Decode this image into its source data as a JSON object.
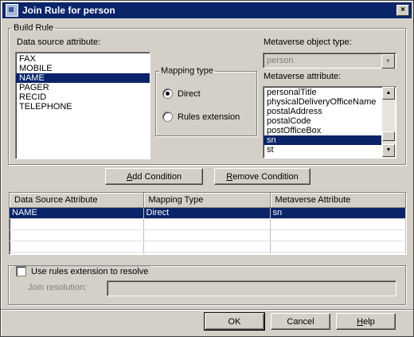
{
  "window": {
    "title": "Join Rule for person",
    "close_glyph": "×"
  },
  "build_rule": {
    "legend": "Build Rule",
    "ds_attr_label": "Data source attribute:",
    "ds_items": [
      {
        "label": "FAX",
        "selected": false
      },
      {
        "label": "MOBILE",
        "selected": false
      },
      {
        "label": "NAME",
        "selected": true
      },
      {
        "label": "PAGER",
        "selected": false
      },
      {
        "label": "RECID",
        "selected": false
      },
      {
        "label": "TELEPHONE",
        "selected": false
      }
    ],
    "mapping_legend": "Mapping type",
    "radio_direct": "Direct",
    "radio_rules": "Rules extension",
    "mv_type_label": "Metaverse object type:",
    "mv_type_value": "person",
    "mv_attr_label": "Metaverse attribute:",
    "mv_items": [
      {
        "label": "personalTitle",
        "selected": false
      },
      {
        "label": "physicalDeliveryOfficeName",
        "selected": false
      },
      {
        "label": "postalAddress",
        "selected": false
      },
      {
        "label": "postalCode",
        "selected": false
      },
      {
        "label": "postOfficeBox",
        "selected": false
      },
      {
        "label": "sn",
        "selected": true
      },
      {
        "label": "st",
        "selected": false
      }
    ]
  },
  "buttons": {
    "add_pre": "",
    "add_ul": "A",
    "add_post": "dd Condition",
    "remove_pre": "",
    "remove_ul": "R",
    "remove_post": "emove Condition",
    "ok": "OK",
    "cancel": "Cancel",
    "help_pre": "",
    "help_ul": "H",
    "help_post": "elp"
  },
  "grid": {
    "headers": [
      "Data Source Attribute",
      "Mapping Type",
      "Metaverse Attribute"
    ],
    "rows": [
      [
        "NAME",
        "Direct",
        "sn"
      ]
    ]
  },
  "resolve": {
    "checkbox_label": "Use rules extension to resolve",
    "join_resolution_label": "Join resolution:"
  }
}
